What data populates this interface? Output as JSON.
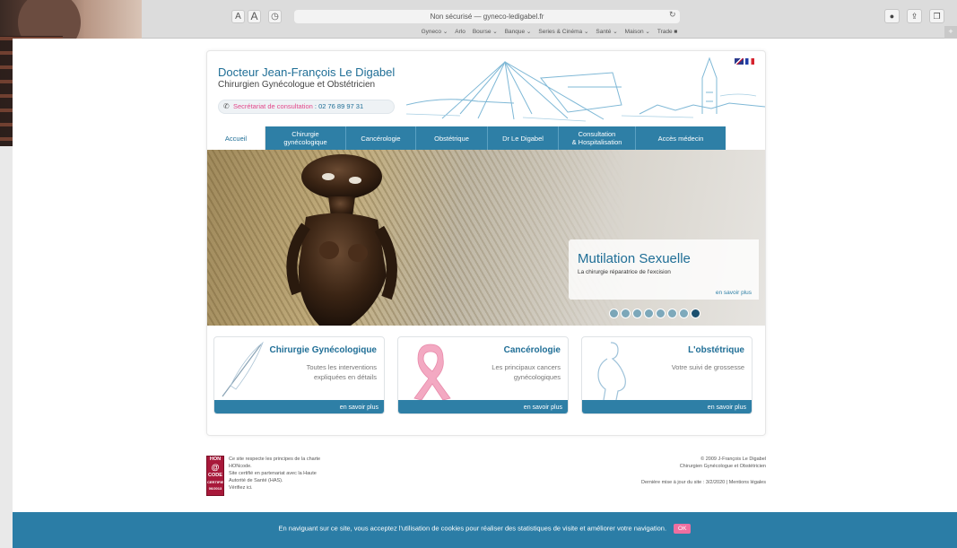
{
  "browser": {
    "text_size_small": "A",
    "text_size_large": "A",
    "address": "Non sécurisé — gyneco-ledigabel.fr",
    "bookmarks": [
      "Gyneco ⌄",
      "Arlo",
      "Bourse ⌄",
      "Banque ⌄",
      "Series & Cinéma ⌄",
      "Santé ⌄",
      "Maison ⌄",
      "Trade ■"
    ]
  },
  "header": {
    "title": "Docteur Jean-François Le Digabel",
    "subtitle": "Chirurgien Gynécologue et Obstétricien",
    "phone_label": "Secrétariat de consultation",
    "phone_number": " : 02 76 89 97 31"
  },
  "nav": {
    "items": [
      {
        "label": "Accueil"
      },
      {
        "label": "Chirurgie\ngynécologique"
      },
      {
        "label": "Cancérologie"
      },
      {
        "label": "Obstétrique"
      },
      {
        "label": "Dr Le Digabel"
      },
      {
        "label": "Consultation\n& Hospitalisation"
      },
      {
        "label": "Accès médecin"
      }
    ]
  },
  "slider": {
    "title": "Mutilation Sexuelle",
    "subtitle": "La chirurgie réparatrice de l'excision",
    "more": "en savoir plus",
    "dot_count": 8,
    "active_dot": 8
  },
  "features": [
    {
      "title": "Chirurgie Gynécologique",
      "desc": "Toutes les interventions expliquées en détails",
      "more": "en savoir plus"
    },
    {
      "title": "Cancérologie",
      "desc": "Les principaux cancers gynécologiques",
      "more": "en savoir plus"
    },
    {
      "title": "L'obstétrique",
      "desc": "Votre suivi de grossesse",
      "more": "en savoir plus"
    }
  ],
  "footer": {
    "hon_logo": [
      "HON",
      "CODE",
      "CERTIFIE",
      "06/2013"
    ],
    "left_lines": [
      "Ce site respecte les principes de la charte",
      "HONcode.",
      "Site certifié en partenariat avec la Haute",
      "Autorité de Santé (HAS).",
      "Vérifiez ici."
    ],
    "copyright": "© 2009 J-François Le Digabel",
    "copyright_sub": "Chirurgien Gynécologue et Obstétricien",
    "updated": "Dernière mise à jour du site : 3/2/2020 | Mentions légales"
  },
  "cookie": {
    "text": "En naviguant sur ce site, vous acceptez l'utilisation de cookies pour réaliser des statistiques de visite et améliorer votre navigation.",
    "ok": "OK"
  },
  "colors": {
    "brand_blue": "#2e7fa6",
    "title_blue": "#1f6e96",
    "pink": "#e2478a",
    "cookie_ok": "#ee6fa0"
  }
}
